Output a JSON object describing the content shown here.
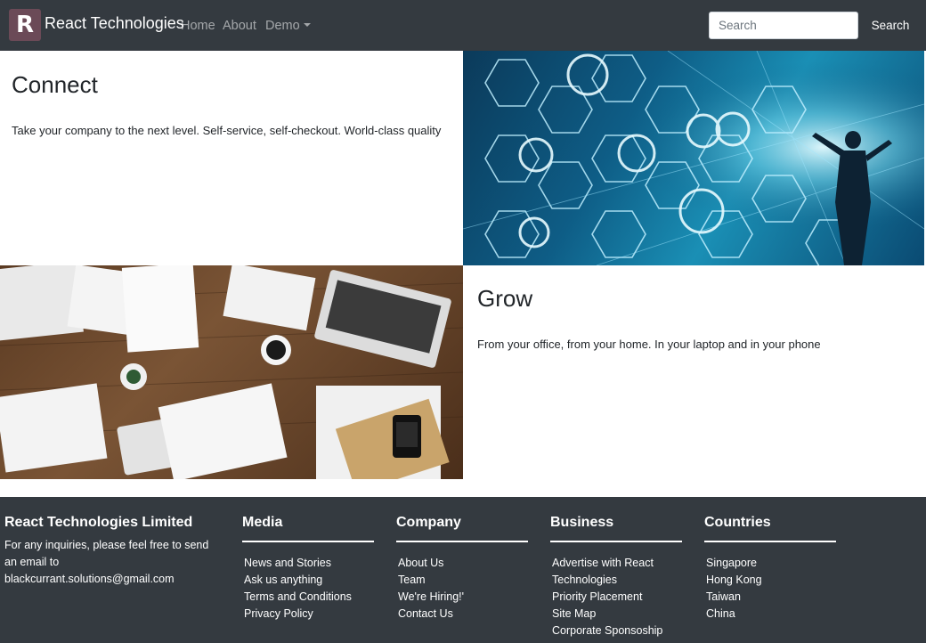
{
  "navbar": {
    "brand_text": "React Technologies",
    "logo_glyph": "R",
    "links": {
      "home": "Home",
      "about": "About",
      "demo": "Demo"
    },
    "search_placeholder": "Search",
    "search_button": "Search",
    "colors": {
      "bg": "#343a40",
      "logo_bg": "#6b4a57"
    }
  },
  "features": {
    "connect": {
      "title": "Connect",
      "text": "Take your company to the next level. Self-service, self-checkout. World-class quality"
    },
    "grow": {
      "title": "Grow",
      "text": "From your office, from your home. In your laptop and in your phone"
    }
  },
  "footer": {
    "about": {
      "title": "React Technologies Limited",
      "text": "For any inquiries, please feel free to send an email to blackcurrant.solutions@gmail.com"
    },
    "media": {
      "title": "Media",
      "items": [
        "News and Stories",
        "Ask us anything",
        "Terms and Conditions",
        "Privacy Policy"
      ]
    },
    "company": {
      "title": "Company",
      "items": [
        "About Us",
        "Team",
        "We're Hiring!'",
        "Contact Us"
      ]
    },
    "business": {
      "title": "Business",
      "items": [
        "Advertise with React Technologies",
        "Priority Placement",
        "Site Map",
        "Corporate Sponsoship"
      ]
    },
    "countries": {
      "title": "Countries",
      "items": [
        "Singapore",
        "Hong Kong",
        "Taiwan",
        "China"
      ]
    }
  }
}
